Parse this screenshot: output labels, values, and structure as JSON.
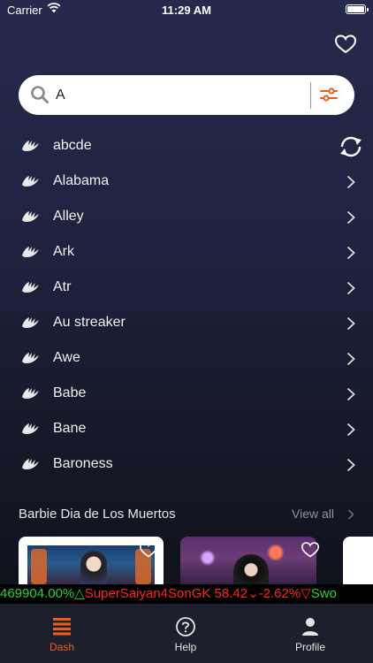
{
  "status_bar": {
    "carrier": "Carrier",
    "time": "11:29 AM"
  },
  "search": {
    "value": "A",
    "placeholder": ""
  },
  "results": [
    {
      "label": "abcde",
      "trailing": "sync-icon"
    },
    {
      "label": "Alabama",
      "trailing": "chevron-right-icon"
    },
    {
      "label": "Alley",
      "trailing": "chevron-right-icon"
    },
    {
      "label": "Ark",
      "trailing": "chevron-right-icon"
    },
    {
      "label": "Atr",
      "trailing": "chevron-right-icon"
    },
    {
      "label": "Au streaker",
      "trailing": "chevron-right-icon"
    },
    {
      "label": "Awe",
      "trailing": "chevron-right-icon"
    },
    {
      "label": "Babe",
      "trailing": "chevron-right-icon"
    },
    {
      "label": "Bane",
      "trailing": "chevron-right-icon"
    },
    {
      "label": "Baroness",
      "trailing": "chevron-right-icon"
    }
  ],
  "section": {
    "title": "Barbie Dia de Los Muertos",
    "view_all": "View all"
  },
  "ticker": {
    "part1": "469904.00%△",
    "part2": " SuperSaiyan4SonGK 58.42",
    "part3": "⌄-2.62%",
    "part4": "▽",
    "part5": " Swo"
  },
  "tabs": {
    "dash": "Dash",
    "help": "Help",
    "profile": "Profile"
  },
  "colors": {
    "accent": "#ee5b1b",
    "ticker_up": "#29d13a",
    "ticker_down": "#ff2424",
    "tab_bar": "#1d202c"
  }
}
